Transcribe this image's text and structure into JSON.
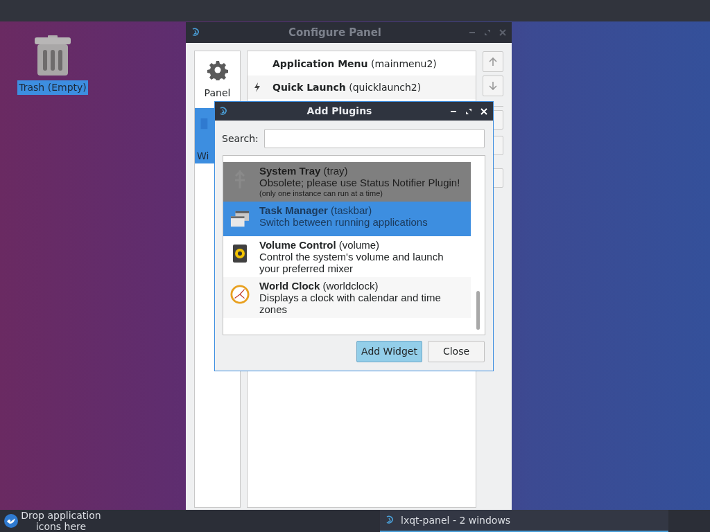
{
  "desktop": {
    "icons": [
      {
        "label": "Trash (Empty)",
        "selected": true
      }
    ]
  },
  "configure_window": {
    "title": "Configure Panel",
    "active": false,
    "sidebar": [
      {
        "label": "Panel",
        "selected": false,
        "kind": "gear"
      },
      {
        "label": "Wi",
        "selected": true,
        "kind": "widgets"
      }
    ],
    "widgets": [
      {
        "text": "**Application Menu** (mainmenu2)",
        "kind": "plain"
      },
      {
        "text": "**Quick Launch** (quicklaunch2)",
        "kind": "launcher"
      }
    ]
  },
  "dialog": {
    "title": "Add Plugins",
    "active": true,
    "search": {
      "label": "Search:"
    },
    "plugins": [
      {
        "title": "**System Tray** (tray)",
        "description": "Obsolete; please use Status Notifier Plugin!",
        "note": "(only one instance can run at a time)",
        "kind": "tray",
        "disabled": true,
        "selected": false
      },
      {
        "title": "**Task Manager** (taskbar)",
        "description": "Switch between running applications",
        "kind": "taskbar",
        "disabled": false,
        "selected": true
      },
      {
        "title": "**Volume Control** (volume)",
        "description": "Control the system's volume and launch your preferred mixer",
        "kind": "volume",
        "disabled": false,
        "selected": false
      },
      {
        "title": "**World Clock** (worldclock)",
        "description": "Displays a clock with calendar and time zones",
        "kind": "clock",
        "disabled": false,
        "selected": false
      }
    ],
    "buttons": [
      {
        "label": "Add Widget",
        "kind": "default"
      },
      {
        "label": "Close",
        "kind": "normal"
      }
    ]
  },
  "taskbar": {
    "drop_hint": "Drop application icons here",
    "tasks": [
      {
        "label": "lxqt-panel - 2 windows",
        "selected": true
      }
    ]
  }
}
